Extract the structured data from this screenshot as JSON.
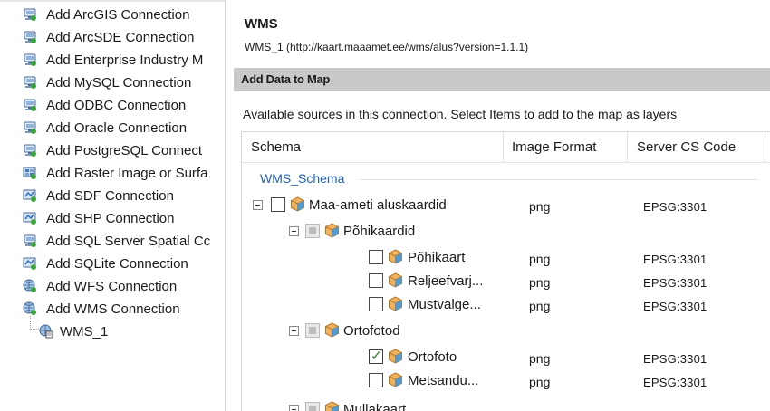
{
  "connections": [
    {
      "label": "Add ArcGIS Connection",
      "icon": "server-connection-icon"
    },
    {
      "label": "Add ArcSDE Connection",
      "icon": "server-connection-icon"
    },
    {
      "label": "Add Enterprise Industry M",
      "icon": "server-connection-icon"
    },
    {
      "label": "Add MySQL Connection",
      "icon": "server-connection-icon"
    },
    {
      "label": "Add ODBC Connection",
      "icon": "server-connection-icon"
    },
    {
      "label": "Add Oracle Connection",
      "icon": "server-connection-icon"
    },
    {
      "label": "Add PostgreSQL Connect",
      "icon": "server-connection-icon"
    },
    {
      "label": "Add Raster Image or Surfa",
      "icon": "raster-connection-icon"
    },
    {
      "label": "Add SDF Connection",
      "icon": "file-connection-icon"
    },
    {
      "label": "Add SHP Connection",
      "icon": "file-connection-icon"
    },
    {
      "label": "Add SQL Server Spatial Cc",
      "icon": "server-connection-icon"
    },
    {
      "label": "Add SQLite Connection",
      "icon": "file-connection-icon"
    },
    {
      "label": "Add WFS Connection",
      "icon": "web-connection-icon"
    },
    {
      "label": "Add WMS Connection",
      "icon": "web-connection-icon"
    }
  ],
  "active_connection": {
    "label": "WMS_1",
    "icon": "wms-layer-icon"
  },
  "detail": {
    "title": "WMS",
    "url": "WMS_1 (http://kaart.maaamet.ee/wms/alus?version=1.1.1)",
    "section_title": "Add Data to Map",
    "sources_text": "Available sources in this connection.  Select Items to add to the map as layers"
  },
  "grid": {
    "columns": [
      "Schema",
      "Image Format",
      "Server CS Code"
    ],
    "schema_label": "WMS_Schema",
    "rows": [
      {
        "name": "Maa-ameti aluskaardid",
        "format": "png",
        "cs": "EPSG:3301",
        "state": "unchecked"
      },
      {
        "name": "Põhikaardid",
        "format": "",
        "cs": "",
        "state": "partial"
      },
      {
        "name": "Põhikaart",
        "format": "png",
        "cs": "EPSG:3301",
        "state": "unchecked"
      },
      {
        "name": "Reljeefvarj...",
        "format": "png",
        "cs": "EPSG:3301",
        "state": "unchecked"
      },
      {
        "name": "Mustvalge...",
        "format": "png",
        "cs": "EPSG:3301",
        "state": "unchecked"
      },
      {
        "name": "Ortofotod",
        "format": "",
        "cs": "",
        "state": "partial"
      },
      {
        "name": "Ortofoto",
        "format": "png",
        "cs": "EPSG:3301",
        "state": "checked"
      },
      {
        "name": "Metsandu...",
        "format": "png",
        "cs": "EPSG:3301",
        "state": "unchecked"
      },
      {
        "name": "Mullakaart",
        "format": "",
        "cs": "",
        "state": "partial"
      }
    ]
  },
  "colors": {
    "section_bar": "#c9c9c9",
    "schema_link": "#1f5fb8",
    "check_mark": "#2a7a2a",
    "cube": "#e8a24a"
  }
}
